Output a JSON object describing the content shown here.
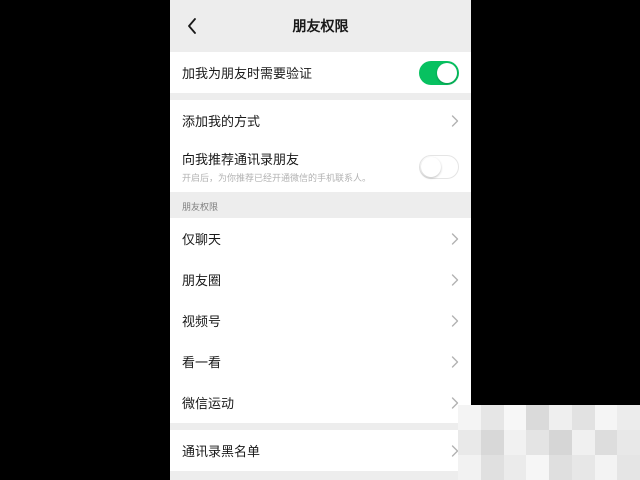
{
  "navbar": {
    "title": "朋友权限",
    "back_icon": "chevron-left-icon"
  },
  "verify": {
    "label": "加我为朋友时需要验证",
    "enabled": true
  },
  "add_methods": {
    "label": "添加我的方式"
  },
  "recommend": {
    "label": "向我推荐通讯录朋友",
    "sublabel": "开启后，为你推荐已经开通微信的手机联系人。",
    "enabled": false
  },
  "permissions": {
    "header": "朋友权限",
    "items": [
      {
        "label": "仅聊天"
      },
      {
        "label": "朋友圈"
      },
      {
        "label": "视频号"
      },
      {
        "label": "看一看"
      },
      {
        "label": "微信运动"
      }
    ]
  },
  "blacklist": {
    "label": "通讯录黑名单"
  },
  "colors": {
    "accent": "#07c160",
    "background": "#ededed",
    "cell": "#ffffff"
  }
}
